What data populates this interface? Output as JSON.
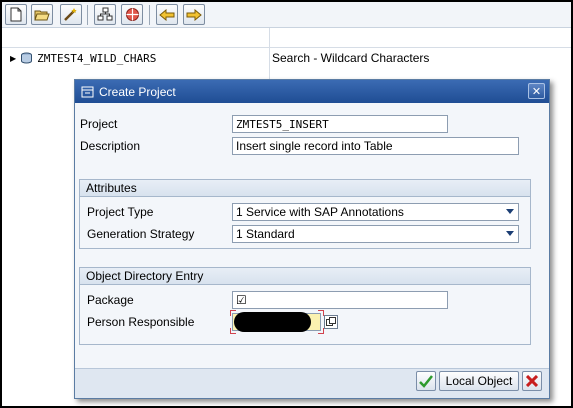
{
  "toolbar": {
    "icons": [
      "new-document-icon",
      "open-folder-icon",
      "edit-wand-icon",
      "hierarchy-icon",
      "stop-icon",
      "back-arrow-icon",
      "forward-arrow-icon"
    ]
  },
  "tree": {
    "item_name": "ZMTEST4_WILD_CHARS",
    "item_description": "Search - Wildcard Characters"
  },
  "dialog": {
    "title": "Create Project",
    "project_label": "Project",
    "project_value": "ZMTEST5_INSERT",
    "description_label": "Description",
    "description_value": "Insert single record into Table",
    "attributes": {
      "header": "Attributes",
      "project_type_label": "Project Type",
      "project_type_value": "1 Service with SAP Annotations",
      "generation_strategy_label": "Generation Strategy",
      "generation_strategy_value": "1 Standard"
    },
    "object_directory": {
      "header": "Object Directory Entry",
      "package_label": "Package",
      "package_value": "☑",
      "person_label": "Person Responsible",
      "person_value": ""
    },
    "buttons": {
      "local_object_label": "Local Object"
    }
  },
  "colors": {
    "title_bar": "#2a5aa4",
    "dialog_bg": "#f3f6fa",
    "confirm_green": "#2e9a2e",
    "cancel_red": "#c81e1e"
  }
}
